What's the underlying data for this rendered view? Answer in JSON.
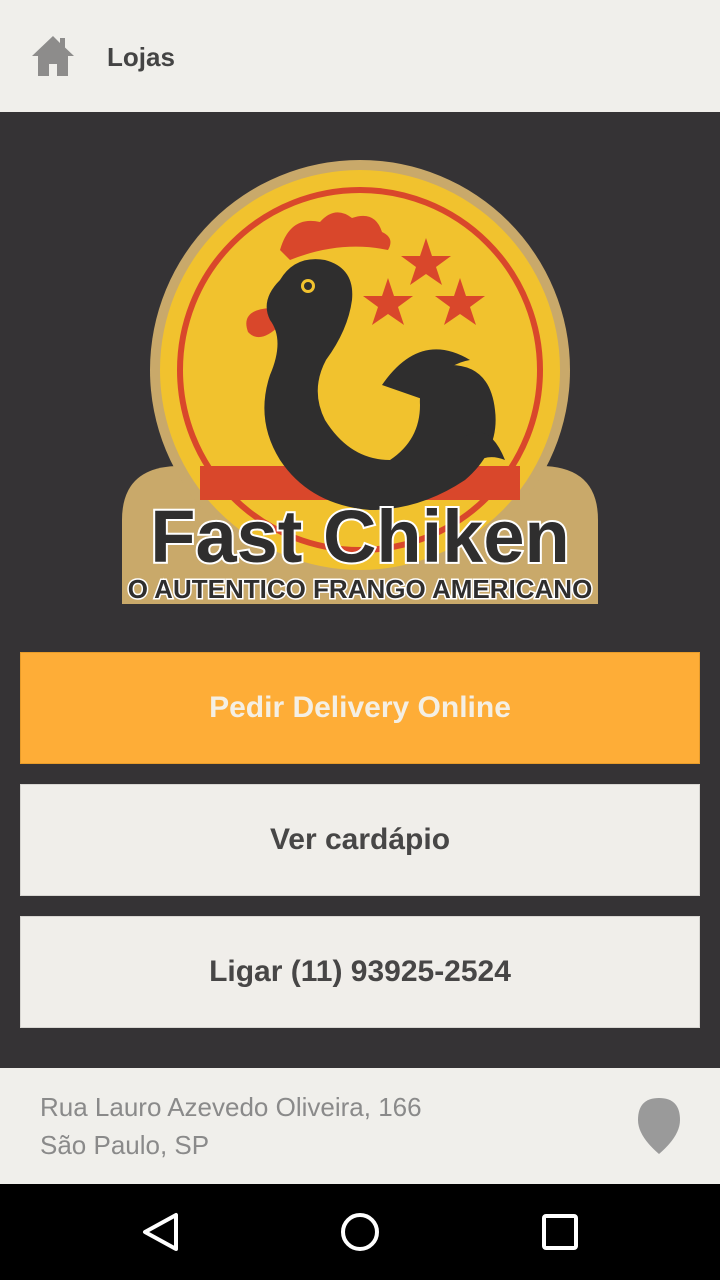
{
  "topbar": {
    "title": "Lojas",
    "home_icon": "home-icon"
  },
  "logo": {
    "brand": "Fast Chiken",
    "tagline": "O AUTENTICO FRANGO AMERICANO"
  },
  "buttons": {
    "delivery": "Pedir Delivery Online",
    "menu": "Ver cardápio",
    "call": "Ligar (11) 93925-2524"
  },
  "footer": {
    "address_line1": "Rua Lauro Azevedo Oliveira, 166",
    "address_line2": "São Paulo, SP",
    "pin_icon": "map-pin-icon"
  },
  "navbar": {
    "back_icon": "back-icon",
    "home_icon": "circle-home-icon",
    "recent_icon": "recent-apps-icon"
  },
  "colors": {
    "accent": "#fead37",
    "background": "#353335",
    "surface": "#f0efeb"
  }
}
